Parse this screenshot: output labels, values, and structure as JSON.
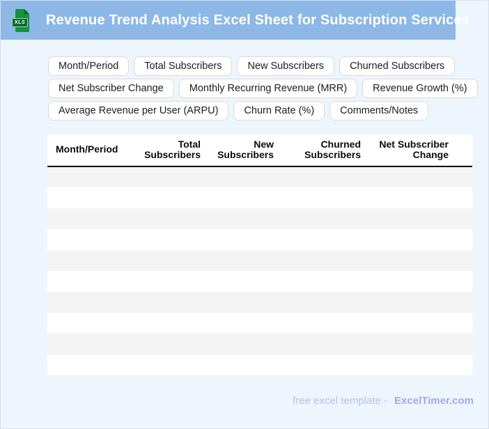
{
  "header": {
    "title": "Revenue Trend Analysis Excel Sheet for Subscription Services",
    "file_icon_label": "XLS"
  },
  "chips": [
    "Month/Period",
    "Total Subscribers",
    "New Subscribers",
    "Churned Subscribers",
    "Net Subscriber Change",
    "Monthly Recurring Revenue (MRR)",
    "Revenue Growth (%)",
    "Average Revenue per User (ARPU)",
    "Churn Rate (%)",
    "Comments/Notes"
  ],
  "table": {
    "columns": [
      "Month/Period",
      "Total Subscribers",
      "New Subscribers",
      "Churned Subscribers",
      "Net Subscriber Change"
    ],
    "rows": [
      [
        "",
        "",
        "",
        "",
        ""
      ],
      [
        "",
        "",
        "",
        "",
        ""
      ],
      [
        "",
        "",
        "",
        "",
        ""
      ],
      [
        "",
        "",
        "",
        "",
        ""
      ],
      [
        "",
        "",
        "",
        "",
        ""
      ],
      [
        "",
        "",
        "",
        "",
        ""
      ],
      [
        "",
        "",
        "",
        "",
        ""
      ],
      [
        "",
        "",
        "",
        "",
        ""
      ],
      [
        "",
        "",
        "",
        "",
        ""
      ],
      [
        "",
        "",
        "",
        "",
        ""
      ]
    ]
  },
  "footer": {
    "text": "free excel template -",
    "brand": "ExcelTimer.com"
  },
  "colors": {
    "header_bg": "#8db8e5",
    "page_bg": "#eef5fd",
    "row_stripe": "#f5f4f4",
    "icon_green": "#15913f",
    "footer_text": "#b6c2ea",
    "footer_brand": "#9dade5"
  }
}
